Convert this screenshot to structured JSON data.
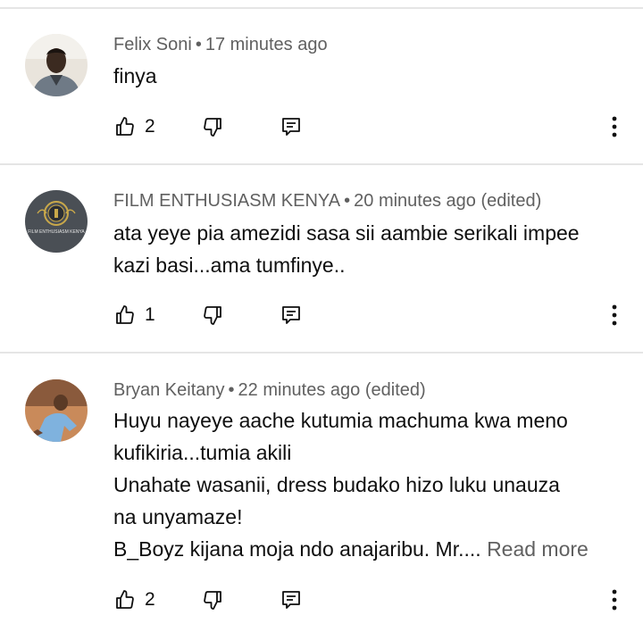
{
  "comments": [
    {
      "author": "Felix Soni",
      "separator": "•",
      "time": "17 minutes ago",
      "lines": [
        "finya"
      ],
      "read_more": "",
      "likes": "2",
      "avatar_icon": "person-photo"
    },
    {
      "author": "FILM ENTHUSIASM KENYA",
      "separator": "•",
      "time": "20 minutes ago (edited)",
      "lines": [
        "ata yeye pia amezidi sasa sii aambie serikali impee",
        "kazi basi...ama tumfinye.."
      ],
      "read_more": "",
      "likes": "1",
      "avatar_icon": "film-enthusiasm-kenya-logo",
      "avatar_text": "FILM ENTHUSIASM KENYA"
    },
    {
      "author": "Bryan Keitany",
      "separator": "•",
      "time": "22 minutes ago (edited)",
      "lines": [
        "Huyu nayeye aache kutumia  machuma kwa meno",
        "kufikiria...tumia akili",
        "Unahate wasanii, dress  budako hizo luku unauza",
        "na unyamaze!",
        "B_Boyz kijana moja ndo anajaribu. Mr.... "
      ],
      "read_more": "Read more",
      "likes": "2",
      "avatar_icon": "footballer-photo"
    }
  ],
  "colors": {
    "text": "#0f0f0f",
    "meta": "#606060",
    "divider": "#e5e5e5"
  }
}
